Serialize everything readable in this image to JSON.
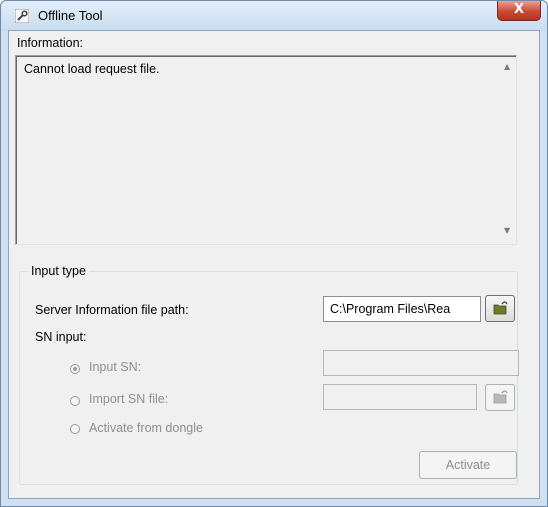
{
  "window": {
    "title": "Offline Tool",
    "close_label": "X",
    "app_icon": "wrench-icon"
  },
  "information": {
    "label": "Information:",
    "text": "Cannot load request file."
  },
  "input_type": {
    "legend": "Input type",
    "server_info_label": "Server Information file path:",
    "server_info_value": "C:\\Program Files\\Rea",
    "sn_input_label": "SN input:",
    "options": [
      {
        "label": "Input SN:",
        "checked": true,
        "enabled": false
      },
      {
        "label": "Import SN file:",
        "checked": false,
        "enabled": false
      },
      {
        "label": "Activate from dongle",
        "checked": false,
        "enabled": false
      }
    ],
    "input_sn_value": "",
    "import_sn_file_value": "",
    "browse_icon": "folder-open-icon"
  },
  "buttons": {
    "activate_label": "Activate"
  },
  "colors": {
    "close_button": "#c94a33",
    "folder_icon": "#6b7d2a",
    "disabled_text": "#8f8f8f"
  }
}
